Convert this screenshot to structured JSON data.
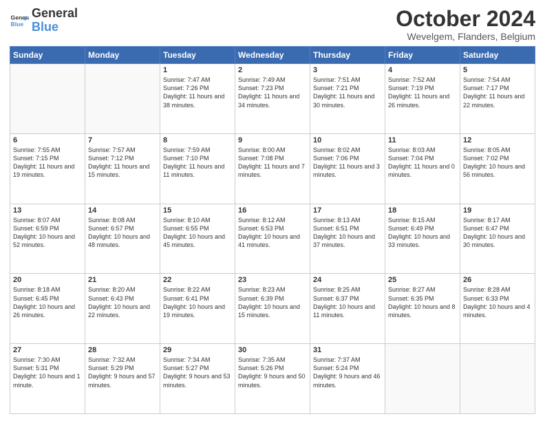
{
  "logo": {
    "line1": "General",
    "line2": "Blue"
  },
  "title": "October 2024",
  "subtitle": "Wevelgem, Flanders, Belgium",
  "weekdays": [
    "Sunday",
    "Monday",
    "Tuesday",
    "Wednesday",
    "Thursday",
    "Friday",
    "Saturday"
  ],
  "weeks": [
    [
      {
        "day": "",
        "info": ""
      },
      {
        "day": "",
        "info": ""
      },
      {
        "day": "1",
        "info": "Sunrise: 7:47 AM\nSunset: 7:26 PM\nDaylight: 11 hours and 38 minutes."
      },
      {
        "day": "2",
        "info": "Sunrise: 7:49 AM\nSunset: 7:23 PM\nDaylight: 11 hours and 34 minutes."
      },
      {
        "day": "3",
        "info": "Sunrise: 7:51 AM\nSunset: 7:21 PM\nDaylight: 11 hours and 30 minutes."
      },
      {
        "day": "4",
        "info": "Sunrise: 7:52 AM\nSunset: 7:19 PM\nDaylight: 11 hours and 26 minutes."
      },
      {
        "day": "5",
        "info": "Sunrise: 7:54 AM\nSunset: 7:17 PM\nDaylight: 11 hours and 22 minutes."
      }
    ],
    [
      {
        "day": "6",
        "info": "Sunrise: 7:55 AM\nSunset: 7:15 PM\nDaylight: 11 hours and 19 minutes."
      },
      {
        "day": "7",
        "info": "Sunrise: 7:57 AM\nSunset: 7:12 PM\nDaylight: 11 hours and 15 minutes."
      },
      {
        "day": "8",
        "info": "Sunrise: 7:59 AM\nSunset: 7:10 PM\nDaylight: 11 hours and 11 minutes."
      },
      {
        "day": "9",
        "info": "Sunrise: 8:00 AM\nSunset: 7:08 PM\nDaylight: 11 hours and 7 minutes."
      },
      {
        "day": "10",
        "info": "Sunrise: 8:02 AM\nSunset: 7:06 PM\nDaylight: 11 hours and 3 minutes."
      },
      {
        "day": "11",
        "info": "Sunrise: 8:03 AM\nSunset: 7:04 PM\nDaylight: 11 hours and 0 minutes."
      },
      {
        "day": "12",
        "info": "Sunrise: 8:05 AM\nSunset: 7:02 PM\nDaylight: 10 hours and 56 minutes."
      }
    ],
    [
      {
        "day": "13",
        "info": "Sunrise: 8:07 AM\nSunset: 6:59 PM\nDaylight: 10 hours and 52 minutes."
      },
      {
        "day": "14",
        "info": "Sunrise: 8:08 AM\nSunset: 6:57 PM\nDaylight: 10 hours and 48 minutes."
      },
      {
        "day": "15",
        "info": "Sunrise: 8:10 AM\nSunset: 6:55 PM\nDaylight: 10 hours and 45 minutes."
      },
      {
        "day": "16",
        "info": "Sunrise: 8:12 AM\nSunset: 6:53 PM\nDaylight: 10 hours and 41 minutes."
      },
      {
        "day": "17",
        "info": "Sunrise: 8:13 AM\nSunset: 6:51 PM\nDaylight: 10 hours and 37 minutes."
      },
      {
        "day": "18",
        "info": "Sunrise: 8:15 AM\nSunset: 6:49 PM\nDaylight: 10 hours and 33 minutes."
      },
      {
        "day": "19",
        "info": "Sunrise: 8:17 AM\nSunset: 6:47 PM\nDaylight: 10 hours and 30 minutes."
      }
    ],
    [
      {
        "day": "20",
        "info": "Sunrise: 8:18 AM\nSunset: 6:45 PM\nDaylight: 10 hours and 26 minutes."
      },
      {
        "day": "21",
        "info": "Sunrise: 8:20 AM\nSunset: 6:43 PM\nDaylight: 10 hours and 22 minutes."
      },
      {
        "day": "22",
        "info": "Sunrise: 8:22 AM\nSunset: 6:41 PM\nDaylight: 10 hours and 19 minutes."
      },
      {
        "day": "23",
        "info": "Sunrise: 8:23 AM\nSunset: 6:39 PM\nDaylight: 10 hours and 15 minutes."
      },
      {
        "day": "24",
        "info": "Sunrise: 8:25 AM\nSunset: 6:37 PM\nDaylight: 10 hours and 11 minutes."
      },
      {
        "day": "25",
        "info": "Sunrise: 8:27 AM\nSunset: 6:35 PM\nDaylight: 10 hours and 8 minutes."
      },
      {
        "day": "26",
        "info": "Sunrise: 8:28 AM\nSunset: 6:33 PM\nDaylight: 10 hours and 4 minutes."
      }
    ],
    [
      {
        "day": "27",
        "info": "Sunrise: 7:30 AM\nSunset: 5:31 PM\nDaylight: 10 hours and 1 minute."
      },
      {
        "day": "28",
        "info": "Sunrise: 7:32 AM\nSunset: 5:29 PM\nDaylight: 9 hours and 57 minutes."
      },
      {
        "day": "29",
        "info": "Sunrise: 7:34 AM\nSunset: 5:27 PM\nDaylight: 9 hours and 53 minutes."
      },
      {
        "day": "30",
        "info": "Sunrise: 7:35 AM\nSunset: 5:26 PM\nDaylight: 9 hours and 50 minutes."
      },
      {
        "day": "31",
        "info": "Sunrise: 7:37 AM\nSunset: 5:24 PM\nDaylight: 9 hours and 46 minutes."
      },
      {
        "day": "",
        "info": ""
      },
      {
        "day": "",
        "info": ""
      }
    ]
  ]
}
